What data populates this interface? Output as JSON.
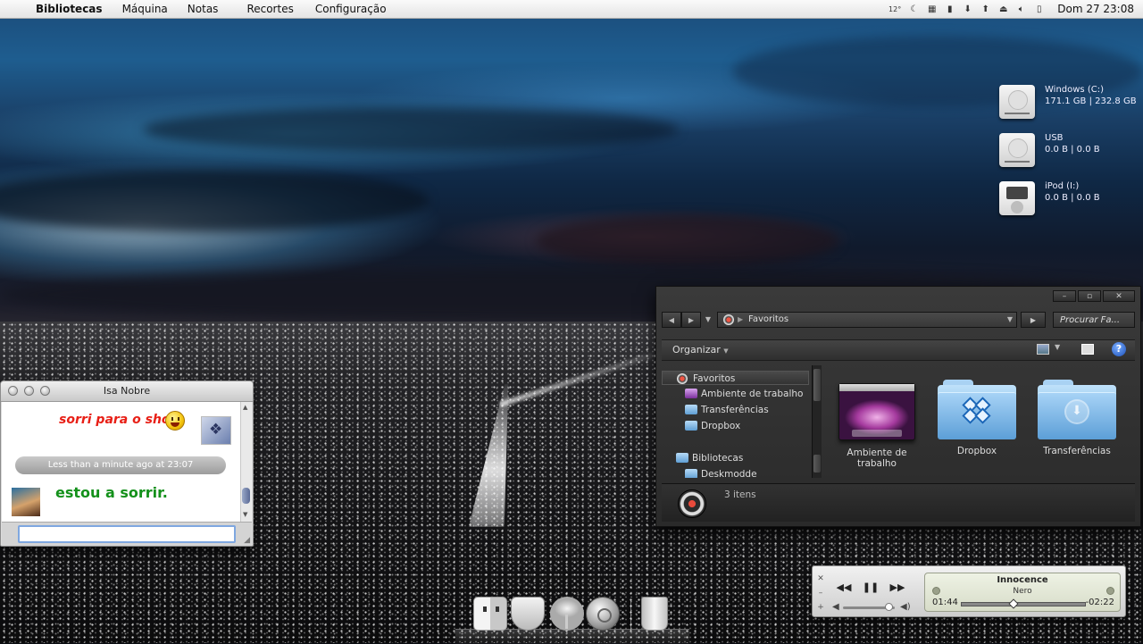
{
  "menubar": {
    "apple_icon": "apple-icon",
    "app_name": "Bibliotecas",
    "menus": [
      "Máquina",
      "Notas",
      "Recortes",
      "Configuração"
    ],
    "temperature": "12°",
    "tray_icons": [
      "moon-icon",
      "grid-icon",
      "bars-icon",
      "download-arrow-icon",
      "upload-icon",
      "eject-icon",
      "volume-icon",
      "battery-icon"
    ],
    "clock": "Dom 27  23:08"
  },
  "drives": [
    {
      "name": "Windows (C:)",
      "size": "171.1 GB |   232.8 GB",
      "icon": "hard-drive-icon"
    },
    {
      "name": "USB",
      "size": "0.0 B |   0.0 B",
      "icon": "usb-drive-icon"
    },
    {
      "name": "iPod (I:)",
      "size": "0.0 B |   0.0 B",
      "icon": "ipod-icon"
    }
  ],
  "chat": {
    "title": "Isa Nobre",
    "message_sent": "sorri para o shot",
    "timestamp": "Less than a minute ago at 23:07",
    "message_received": "estou a sorrir.",
    "input_value": ""
  },
  "explorer": {
    "address": "Favoritos",
    "search_placeholder": "Procurar Fa...",
    "organize_label": "Organizar",
    "nav_items": [
      {
        "label": "Favoritos",
        "level": 0,
        "selected": true,
        "icon": "favorites-icon"
      },
      {
        "label": "Ambiente de trabalho",
        "level": 1,
        "selected": false,
        "icon": "desktop-icon"
      },
      {
        "label": "Transferências",
        "level": 1,
        "selected": false,
        "icon": "folder-icon"
      },
      {
        "label": "Dropbox",
        "level": 1,
        "selected": false,
        "icon": "dropbox-icon"
      },
      {
        "label": "Bibliotecas",
        "level": 0,
        "selected": false,
        "icon": "folder-icon"
      },
      {
        "label": "Deskmodde",
        "level": 1,
        "selected": false,
        "icon": "folder-icon"
      }
    ],
    "items": [
      {
        "label": "Ambiente de trabalho",
        "icon": "desktop-thumbnail"
      },
      {
        "label": "Dropbox",
        "icon": "dropbox-folder-icon"
      },
      {
        "label": "Transferências",
        "icon": "downloads-folder-icon"
      }
    ],
    "status_text": "3 itens"
  },
  "player": {
    "title": "Innocence",
    "artist": "Nero",
    "elapsed": "01:44",
    "remaining": "-02:22",
    "progress": 0.42,
    "volume": 0.88
  }
}
